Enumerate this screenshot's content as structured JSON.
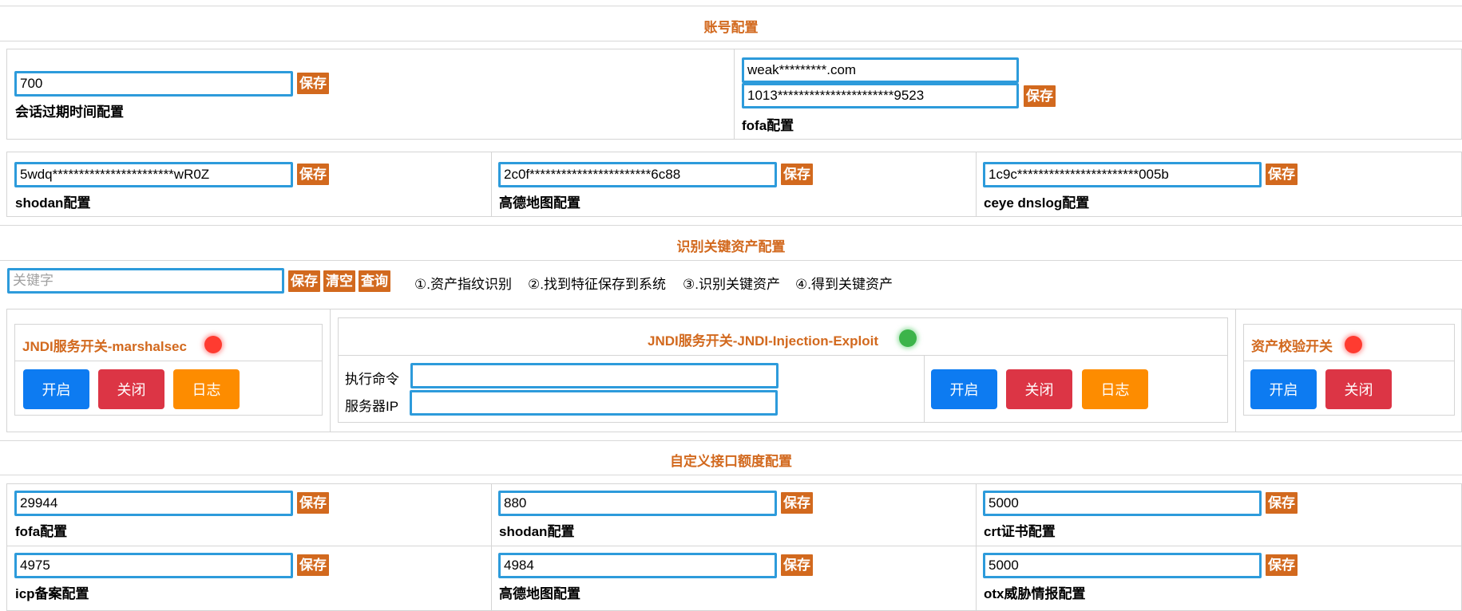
{
  "account_section": {
    "title": "账号配置",
    "session": {
      "value": "700",
      "save": "保存",
      "label": "会话过期时间配置"
    },
    "fofa": {
      "email": "weak*********.com",
      "key": "1013**********************9523",
      "save": "保存",
      "label": "fofa配置"
    },
    "shodan": {
      "value": "5wdq***********************wR0Z",
      "save": "保存",
      "label": "shodan配置"
    },
    "amap": {
      "value": "2c0f***********************6c88",
      "save": "保存",
      "label": "高德地图配置"
    },
    "ceye": {
      "value": "1c9c***********************005b",
      "save": "保存",
      "label": "ceye dnslog配置"
    }
  },
  "asset_section": {
    "title": "识别关键资产配置",
    "keyword_placeholder": "关键字",
    "save": "保存",
    "clear": "清空",
    "query": "查询",
    "steps": [
      "①.资产指纹识别",
      "②.找到特征保存到系统",
      "③.识别关键资产",
      "④.得到关键资产"
    ]
  },
  "jndi_marshalsec": {
    "title": "JNDI服务开关-marshalsec",
    "status_color": "#ff3b30",
    "start": "开启",
    "stop": "关闭",
    "log": "日志"
  },
  "jndi_exploit": {
    "title": "JNDI服务开关-JNDI-Injection-Exploit",
    "status_color": "#3cb44a",
    "cmd_label": "执行命令",
    "ip_label": "服务器IP",
    "cmd_value": "",
    "ip_value": "",
    "start": "开启",
    "stop": "关闭",
    "log": "日志"
  },
  "asset_check": {
    "title": "资产校验开关",
    "status_color": "#ff3b30",
    "start": "开启",
    "stop": "关闭"
  },
  "quota_section": {
    "title": "自定义接口额度配置",
    "items": [
      {
        "value": "29944",
        "save": "保存",
        "label": "fofa配置"
      },
      {
        "value": "880",
        "save": "保存",
        "label": "shodan配置"
      },
      {
        "value": "5000",
        "save": "保存",
        "label": "crt证书配置"
      },
      {
        "value": "4975",
        "save": "保存",
        "label": "icp备案配置"
      },
      {
        "value": "4984",
        "save": "保存",
        "label": "高德地图配置"
      },
      {
        "value": "5000",
        "save": "保存",
        "label": "otx威胁情报配置"
      }
    ]
  },
  "colors": {
    "accent": "#d2691e",
    "input_border": "#2d9bdb",
    "blue": "#0d7bf1",
    "red": "#dc3545",
    "orange": "#fd8c00"
  }
}
